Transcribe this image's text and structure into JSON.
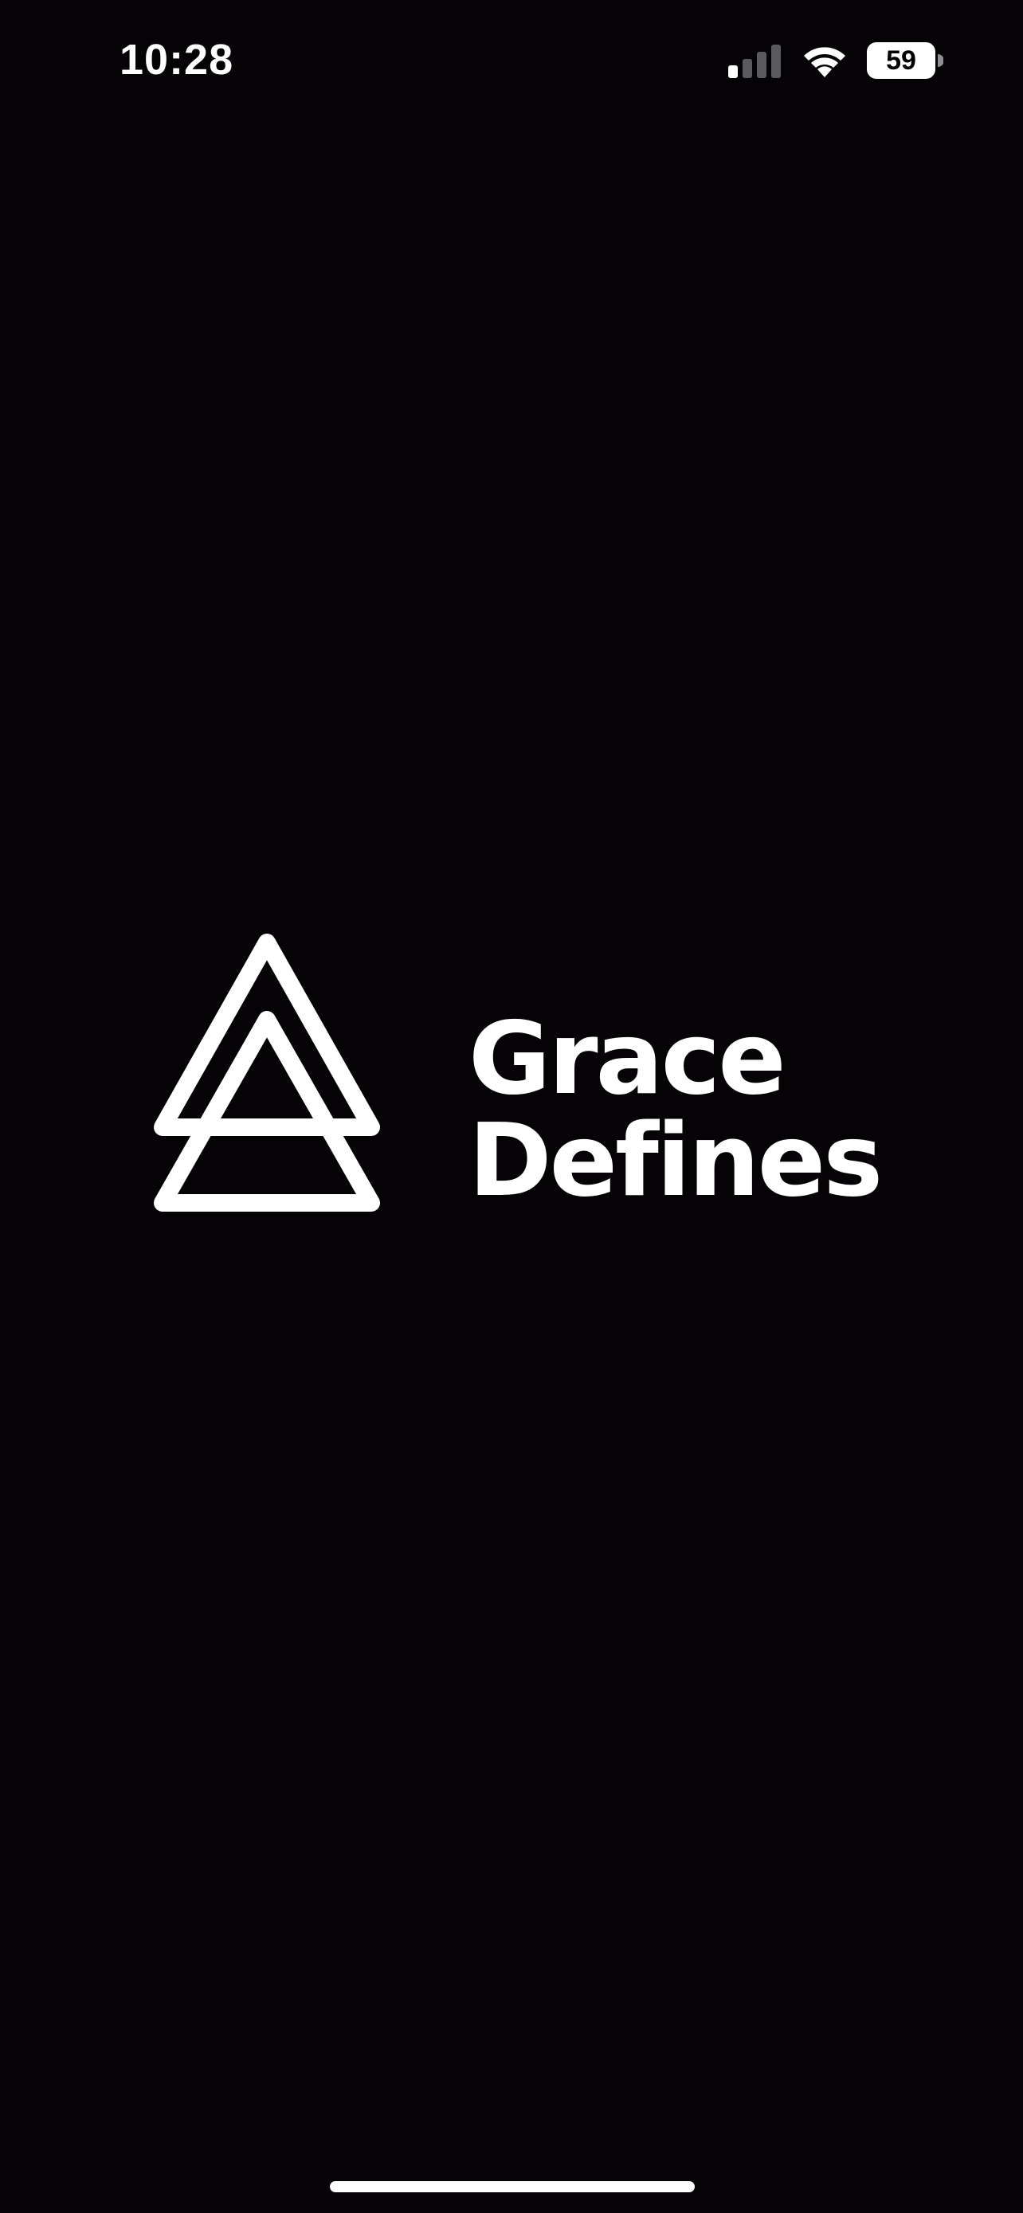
{
  "status_bar": {
    "time": "10:28",
    "battery_level": "59",
    "signal_icon": "cellular-signal-icon",
    "wifi_icon": "wifi-icon",
    "battery_icon": "battery-icon"
  },
  "splash": {
    "logo_icon": "stacked-triangles-logo-icon",
    "brand_line_1": "Grace",
    "brand_line_2": "Defines"
  },
  "colors": {
    "background": "#050306",
    "foreground": "#ffffff",
    "signal_inactive": "#5a5a5e"
  }
}
